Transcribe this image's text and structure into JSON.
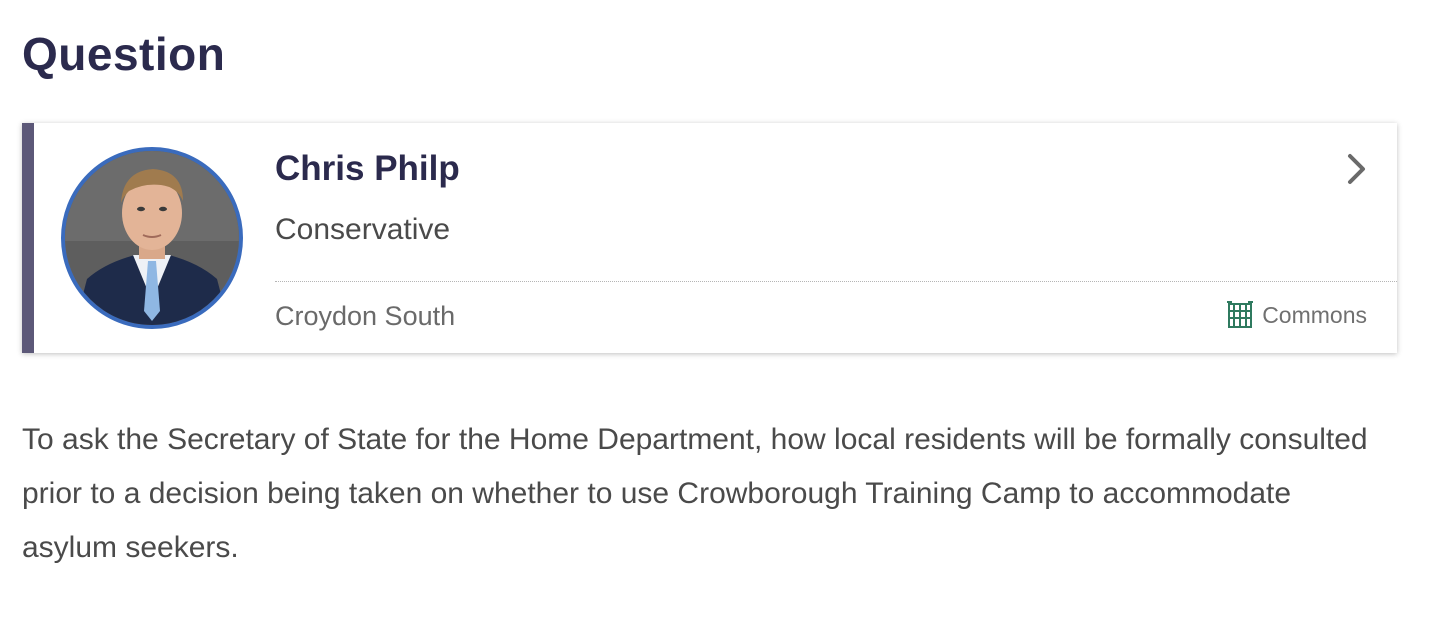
{
  "section": {
    "heading": "Question"
  },
  "member": {
    "name": "Chris Philp",
    "party": "Conservative",
    "constituency": "Croydon South",
    "house": "Commons",
    "avatar_icon": "member-portrait",
    "house_icon": "portcullis-icon",
    "nav_icon": "chevron-right-icon",
    "party_color": "#5c5878",
    "avatar_border_color": "#3a6bbd",
    "house_color": "#2f7a5f"
  },
  "question": {
    "text": "To ask the Secretary of State for the Home Department, how local residents will be formally consulted prior to a decision being taken on whether to use Crowborough Training Camp to accommodate asylum seekers."
  }
}
